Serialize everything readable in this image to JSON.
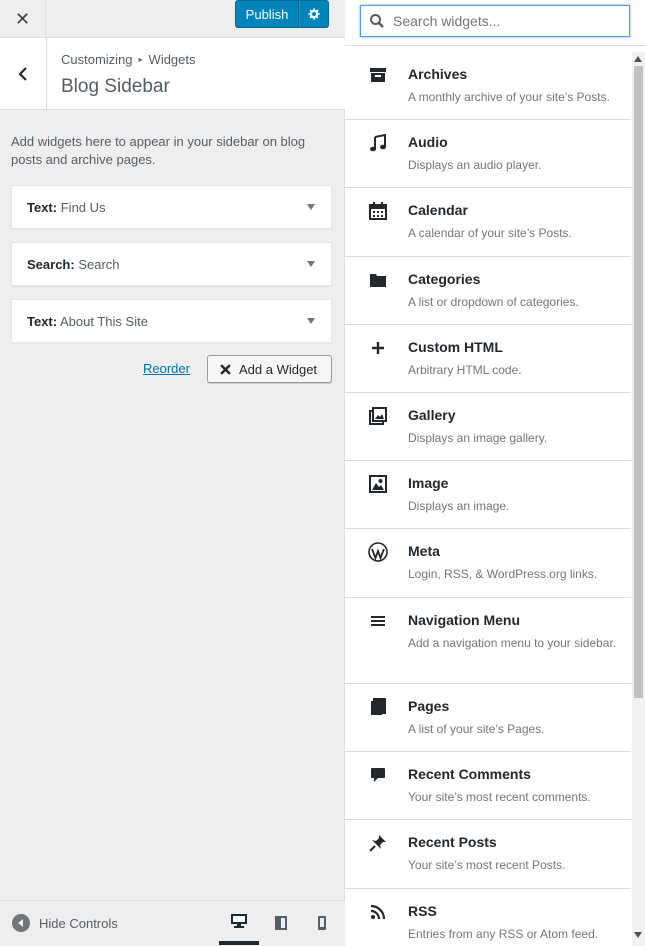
{
  "topbar": {
    "close_icon": "close-icon",
    "publish_label": "Publish",
    "settings_icon": "gear-icon"
  },
  "section": {
    "breadcrumb_parent": "Customizing",
    "breadcrumb_child": "Widgets",
    "title": "Blog Sidebar",
    "description": "Add widgets here to appear in your sidebar on blog posts and archive pages."
  },
  "widgets": [
    {
      "type": "Text:",
      "name": "Find Us"
    },
    {
      "type": "Search:",
      "name": "Search"
    },
    {
      "type": "Text:",
      "name": "About This Site"
    }
  ],
  "actions": {
    "reorder_label": "Reorder",
    "add_widget_label": "Add a Widget"
  },
  "footer": {
    "hide_controls_label": "Hide Controls",
    "devices": [
      "desktop",
      "tablet",
      "mobile"
    ],
    "active_device": "desktop"
  },
  "search": {
    "placeholder": "Search widgets..."
  },
  "available_widgets": [
    {
      "name": "Archives",
      "desc": "A monthly archive of your site’s Posts.",
      "icon": "archive-icon"
    },
    {
      "name": "Audio",
      "desc": "Displays an audio player.",
      "icon": "music-note-icon"
    },
    {
      "name": "Calendar",
      "desc": "A calendar of your site’s Posts.",
      "icon": "calendar-icon"
    },
    {
      "name": "Categories",
      "desc": "A list or dropdown of categories.",
      "icon": "folder-icon"
    },
    {
      "name": "Custom HTML",
      "desc": "Arbitrary HTML code.",
      "icon": "plus-icon"
    },
    {
      "name": "Gallery",
      "desc": "Displays an image gallery.",
      "icon": "gallery-icon"
    },
    {
      "name": "Image",
      "desc": "Displays an image.",
      "icon": "image-icon"
    },
    {
      "name": "Meta",
      "desc": "Login, RSS, & WordPress.org links.",
      "icon": "wordpress-icon"
    },
    {
      "name": "Navigation Menu",
      "desc": "Add a navigation menu to your sidebar.",
      "icon": "menu-icon"
    },
    {
      "name": "Pages",
      "desc": "A list of your site’s Pages.",
      "icon": "pages-icon"
    },
    {
      "name": "Recent Comments",
      "desc": "Your site’s most recent comments.",
      "icon": "comment-icon"
    },
    {
      "name": "Recent Posts",
      "desc": "Your site’s most recent Posts.",
      "icon": "pin-icon"
    },
    {
      "name": "RSS",
      "desc": "Entries from any RSS or Atom feed.",
      "icon": "rss-icon"
    }
  ],
  "colors": {
    "accent": "#0085ba",
    "link": "#0073aa",
    "panel_bg": "#eeeeee"
  }
}
